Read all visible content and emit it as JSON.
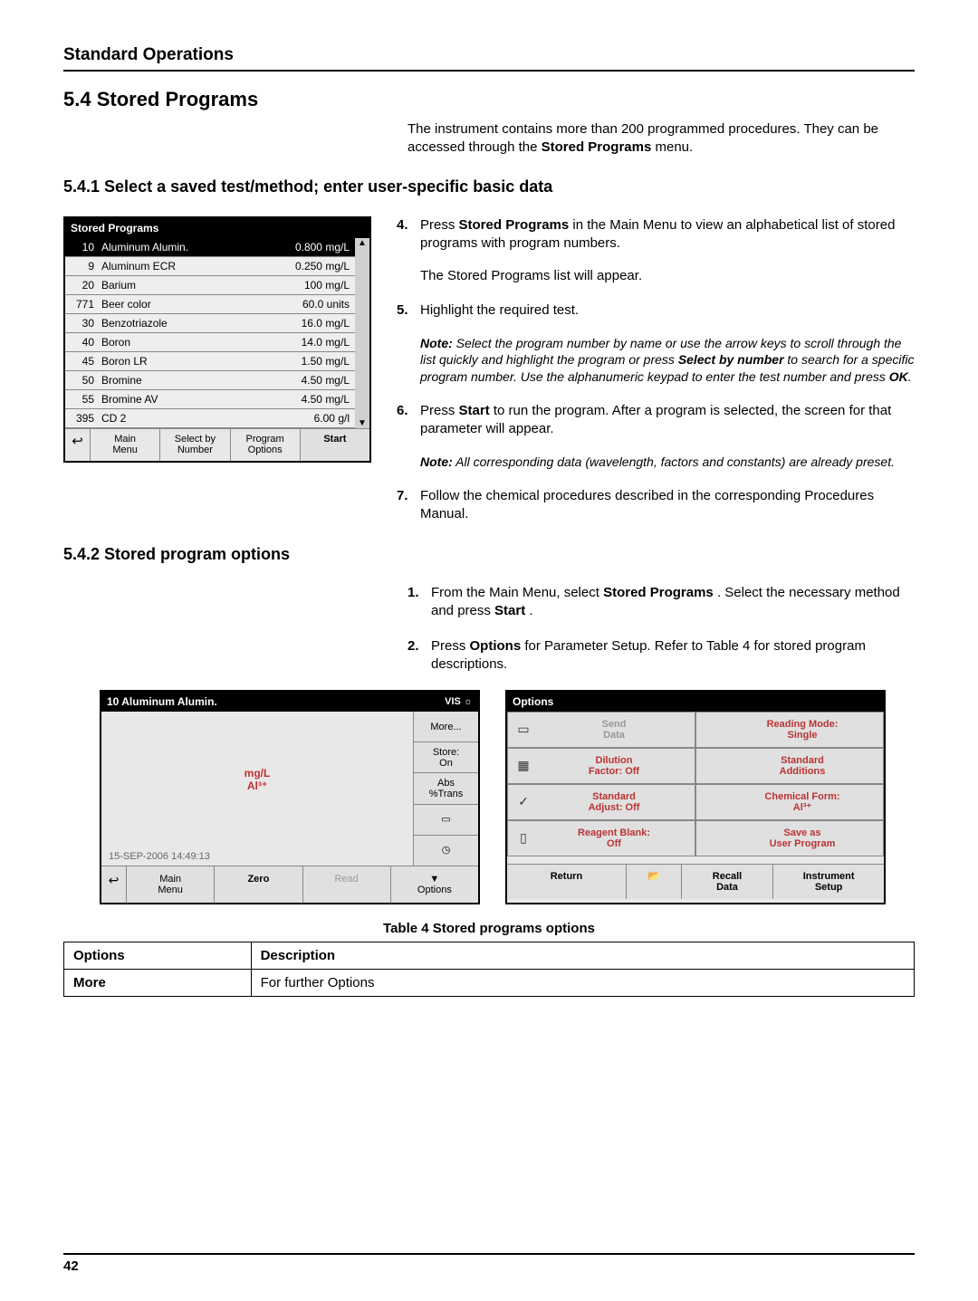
{
  "header": {
    "title": "Standard Operations"
  },
  "section_5_4": {
    "title": "5.4  Stored Programs",
    "intro": "The instrument contains more than 200 programmed procedures. They can be accessed through the ",
    "intro_bold": "Stored Programs",
    "intro_tail": " menu."
  },
  "section_5_4_1": {
    "title": "5.4.1  Select a saved test/method; enter user-specific basic data"
  },
  "stored_programs_panel": {
    "title": "Stored Programs",
    "rows": [
      {
        "num": "10",
        "name": "Aluminum Alumin.",
        "val": "0.800 mg/L",
        "selected": true
      },
      {
        "num": "9",
        "name": "Aluminum ECR",
        "val": "0.250 mg/L"
      },
      {
        "num": "20",
        "name": "Barium",
        "val": "100 mg/L"
      },
      {
        "num": "771",
        "name": "Beer color",
        "val": "60.0 units"
      },
      {
        "num": "30",
        "name": "Benzotriazole",
        "val": "16.0 mg/L"
      },
      {
        "num": "40",
        "name": "Boron",
        "val": "14.0 mg/L"
      },
      {
        "num": "45",
        "name": "Boron LR",
        "val": "1.50 mg/L"
      },
      {
        "num": "50",
        "name": "Bromine",
        "val": "4.50 mg/L"
      },
      {
        "num": "55",
        "name": "Bromine AV",
        "val": "4.50 mg/L"
      },
      {
        "num": "395",
        "name": "CD 2",
        "val": "6.00 g/l"
      }
    ],
    "buttons": {
      "back": "↩",
      "main_menu": "Main\nMenu",
      "select_by_number": "Select by\nNumber",
      "program_options": "Program\nOptions",
      "start": "Start"
    },
    "scroll_up": "▲",
    "scroll_down": "▼"
  },
  "instr_5_4_1": {
    "step4_pre": "Press ",
    "step4_bold": "Stored Programs",
    "step4_post": " in the Main Menu to view an alphabetical list of stored programs with program numbers.",
    "step4_sub": "The Stored Programs list will appear.",
    "step5": "Highlight the required test.",
    "step5_note_pre": "Note:",
    "step5_note_body": " Select the program number by name or use the arrow keys to scroll through the list quickly and highlight the program or press ",
    "step5_note_bold": "Select by number",
    "step5_note_body2": " to search for a specific program number. Use the alphanumeric keypad to enter the test number and press ",
    "step5_note_bold2": "OK",
    "step5_note_tail": ".",
    "step6_pre": "Press ",
    "step6_bold": "Start",
    "step6_post": " to run the program. After a program is selected, the screen for that parameter will appear.",
    "step6_note_pre": "Note:",
    "step6_note_body": " All corresponding data (wavelength, factors and constants) are already preset.",
    "step7": "Follow the chemical procedures described in the corresponding Procedures Manual."
  },
  "section_5_4_2": {
    "title": "5.4.2  Stored program options",
    "step1_pre": "From the Main Menu, select ",
    "step1_bold": "Stored Programs",
    "step1_mid": ". Select the necessary method and press ",
    "step1_bold2": "Start",
    "step1_tail": ".",
    "step2_pre": "Press ",
    "step2_bold": "Options",
    "step2_post": " for Parameter Setup. Refer to Table 4 for stored program descriptions."
  },
  "measure_panel": {
    "title": "10 Aluminum Alumin.",
    "vis": "VIS ☼",
    "unit1": "mg/L",
    "unit2": "Al³⁺",
    "side": {
      "more": "More...",
      "store": "Store:\nOn",
      "abs": "Abs\n%Trans",
      "icon1": "▭",
      "icon2": "◷"
    },
    "datetime": "15-SEP-2006  14:49:13",
    "bottom": {
      "back": "↩",
      "main_menu": "Main\nMenu",
      "zero": "Zero",
      "read": "Read",
      "options": "▼\nOptions"
    }
  },
  "options_panel": {
    "title": "Options",
    "cells": [
      {
        "icon": "▭",
        "text": "Send\nData",
        "grey": true
      },
      {
        "icon": "",
        "text": "Reading Mode:\nSingle",
        "red": true
      },
      {
        "icon": "▦",
        "text": "Dilution\nFactor: Off",
        "red": true
      },
      {
        "icon": "",
        "text": "Standard\nAdditions",
        "red": true
      },
      {
        "icon": "✓",
        "text": "Standard\nAdjust: Off",
        "red": true
      },
      {
        "icon": "",
        "text": "Chemical Form:\nAl³⁺",
        "red": true
      },
      {
        "icon": "▯",
        "text": "Reagent Blank:\nOff",
        "red": true
      },
      {
        "icon": "",
        "text": "Save as\nUser Program",
        "red": true
      }
    ],
    "bottom": {
      "return": "Return",
      "folder": "📂",
      "recall": "Recall\nData",
      "instrument": "Instrument\nSetup"
    }
  },
  "table4": {
    "caption": "Table 4  Stored programs options",
    "headers": {
      "c1": "Options",
      "c2": "Description"
    },
    "rows": [
      {
        "c1": "More",
        "c2": "For further Options"
      }
    ]
  },
  "footer": {
    "page": "42"
  }
}
